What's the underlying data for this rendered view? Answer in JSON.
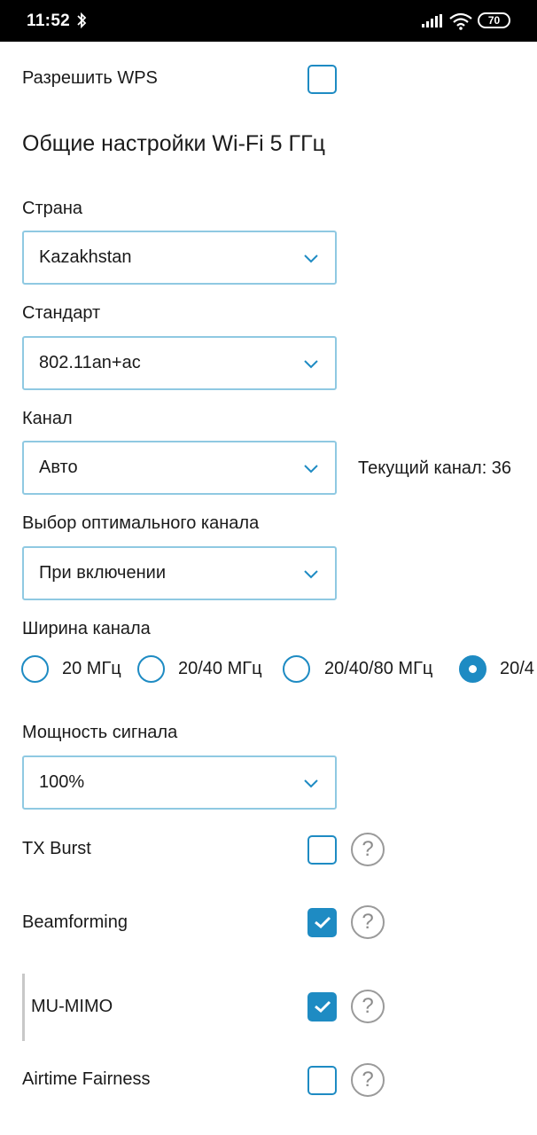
{
  "status_bar": {
    "time": "11:52",
    "battery": "70",
    "icons": [
      "bluetooth-icon",
      "signal-icon",
      "wifi-icon",
      "battery-icon"
    ]
  },
  "wps": {
    "label": "Разрешить WPS",
    "checked": false
  },
  "section_title": "Общие настройки Wi-Fi 5 ГГц",
  "country": {
    "label": "Страна",
    "value": "Kazakhstan"
  },
  "standard": {
    "label": "Стандарт",
    "value": "802.11an+ac"
  },
  "channel": {
    "label": "Канал",
    "value": "Авто",
    "current": "Текущий канал: 36"
  },
  "optimal_channel": {
    "label": "Выбор оптимального канала",
    "value": "При включении"
  },
  "channel_width": {
    "label": "Ширина канала",
    "options": [
      "20 МГц",
      "20/40 МГц",
      "20/40/80 МГц",
      "20/4"
    ],
    "selected_index": 3
  },
  "signal_power": {
    "label": "Мощность сигнала",
    "value": "100%"
  },
  "toggles": [
    {
      "label": "TX Burst",
      "checked": false,
      "help": "?"
    },
    {
      "label": "Beamforming",
      "checked": true,
      "help": "?"
    },
    {
      "label": "MU-MIMO",
      "checked": true,
      "help": "?"
    },
    {
      "label": "Airtime Fairness",
      "checked": false,
      "help": "?"
    }
  ],
  "colors": {
    "accent": "#1e8bc3",
    "select_border": "#8fc9e2",
    "help_gray": "#9a9a9a",
    "statusbar_bg": "#000000"
  }
}
